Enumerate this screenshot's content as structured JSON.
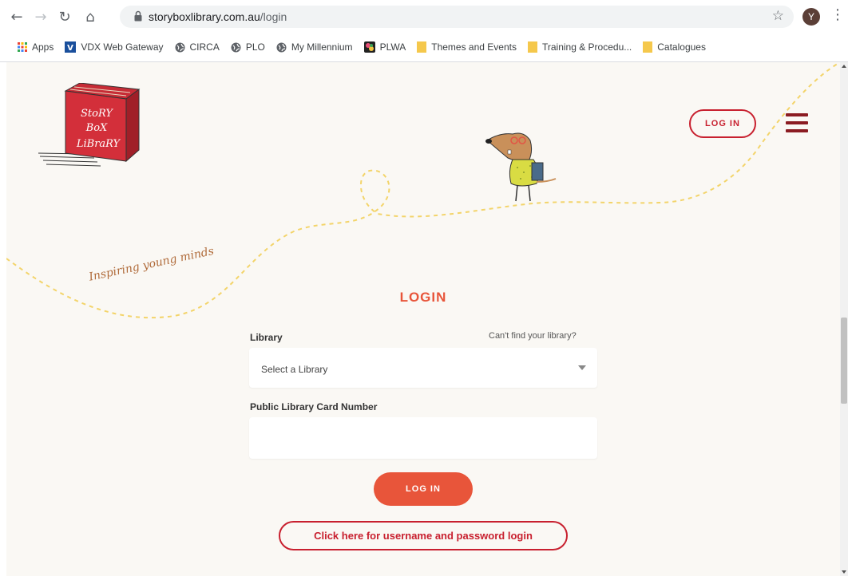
{
  "browser": {
    "url_host": "storyboxlibrary.com.au",
    "url_path": "/login",
    "profile_initial": "Y",
    "bookmarks": [
      {
        "label": "Apps",
        "icon": "apps-grid-icon"
      },
      {
        "label": "VDX Web Gateway",
        "icon": "vdx-icon"
      },
      {
        "label": "CIRCA",
        "icon": "globe-icon"
      },
      {
        "label": "PLO",
        "icon": "globe-icon"
      },
      {
        "label": "My Millennium",
        "icon": "globe-icon"
      },
      {
        "label": "PLWA",
        "icon": "plwa-icon"
      },
      {
        "label": "Themes and Events",
        "icon": "folder-icon"
      },
      {
        "label": "Training & Procedu...",
        "icon": "folder-icon"
      },
      {
        "label": "Catalogues",
        "icon": "folder-icon"
      }
    ]
  },
  "site": {
    "logo_lines": [
      "StoRY",
      "BoX",
      "LiBraRY"
    ],
    "tagline": "Inspiring young minds",
    "header_login": "LOG IN"
  },
  "form": {
    "title": "LOGIN",
    "library_label": "Library",
    "cant_find": "Can't find your library?",
    "library_select_value": "Select a Library",
    "card_label": "Public Library Card Number",
    "card_value": "",
    "submit": "LOG IN",
    "alt_login": "Click here for username and password login"
  },
  "colors": {
    "accent": "#e8553a",
    "brand_red": "#c8202f",
    "menu": "#8b1c22",
    "page_bg": "#faf8f4",
    "trail": "#f3d46a"
  }
}
